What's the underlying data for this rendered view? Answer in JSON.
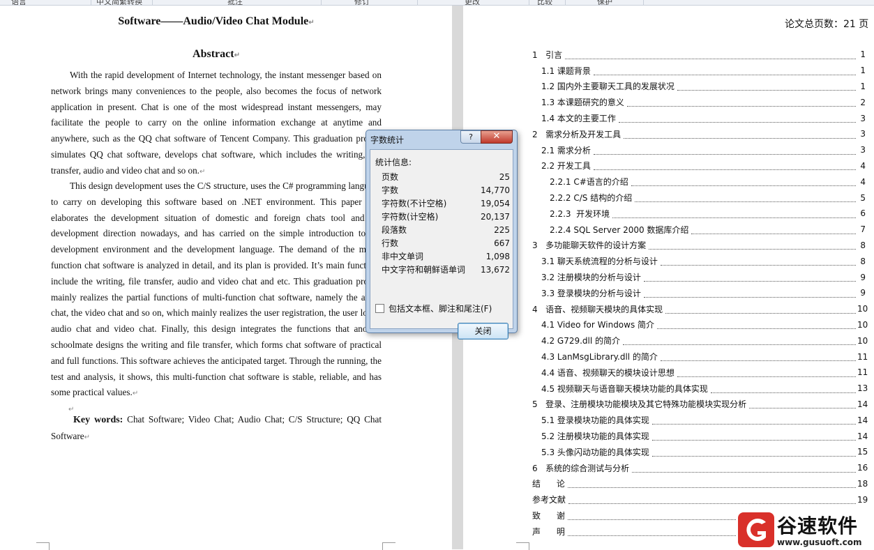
{
  "ribbon": [
    "语言",
    "中文简繁转换",
    "批注",
    "修订",
    "更改",
    "比较",
    "保护"
  ],
  "left": {
    "title": "Software——Audio/Video Chat Module",
    "abstract_heading": "Abstract",
    "para1": "With the rapid development of Internet technology, the instant messenger based on network brings many conveniences to the people, also becomes the focus of network application in present. Chat is one of the most widespread instant messengers, may facilitate the people to carry on the online information exchange at anytime and anywhere, such as the QQ chat software of Tencent Company. This graduation project simulates QQ chat software, develops chat software, which includes the writing, file transfer, audio and video chat and so on.",
    "para2": "This design development uses the C/S structure, uses the C# programming language to carry on developing this software based on .NET environment. This paper first elaborates the development situation of domestic and foreign chats tool and the development direction nowadays, and has carried on the simple introduction to the development environment and the development language. The demand of the multi-function chat software is analyzed in detail, and its plan is provided. It’s main functions include the writing, file transfer, audio and video chat and etc. This graduation project mainly realizes the partial functions of multi-function chat software, namely the audio chat, the video chat and so on, which mainly realizes the user registration, the user login, audio chat and video chat. Finally, this design integrates the functions that another schoolmate designs the writing and file transfer, which forms chat software of practical and full functions. This software achieves the anticipated target. Through the running, the test and analysis, it shows, this multi-function chat software is stable, reliable, and has some practical values.",
    "keywords_label": "Key words:",
    "keywords": " Chat Software; Video Chat; Audio Chat; C/S Structure; QQ Chat Software"
  },
  "right": {
    "total_pages": "论文总页数：21 页",
    "toc": [
      {
        "text": "1   引言",
        "page": "1",
        "level": 1
      },
      {
        "text": "1.1 课题背景",
        "page": "1",
        "level": 2
      },
      {
        "text": "1.2 国内外主要聊天工具的发展状况",
        "page": "1",
        "level": 2
      },
      {
        "text": "1.3 本课题研究的意义",
        "page": "2",
        "level": 2
      },
      {
        "text": "1.4 本文的主要工作",
        "page": "3",
        "level": 2
      },
      {
        "text": "2   需求分析及开发工具",
        "page": "3",
        "level": 1
      },
      {
        "text": "2.1 需求分析",
        "page": "3",
        "level": 2
      },
      {
        "text": "2.2 开发工具",
        "page": "4",
        "level": 2
      },
      {
        "text": "2.2.1 C#语言的介绍",
        "page": "4",
        "level": 3
      },
      {
        "text": "2.2.2 C/S 结构的介绍",
        "page": "5",
        "level": 3
      },
      {
        "text": "2.2.3  开发环境",
        "page": "6",
        "level": 3
      },
      {
        "text": "2.2.4 SQL Server 2000 数据库介绍",
        "page": "7",
        "level": 3
      },
      {
        "text": "3   多功能聊天软件的设计方案",
        "page": "8",
        "level": 1
      },
      {
        "text": "3.1 聊天系统流程的分析与设计",
        "page": "8",
        "level": 2
      },
      {
        "text": "3.2 注册模块的分析与设计",
        "page": "9",
        "level": 2
      },
      {
        "text": "3.3 登录模块的分析与设计",
        "page": "9",
        "level": 2
      },
      {
        "text": "4   语音、视频聊天模块的具体实现",
        "page": "10",
        "level": 1
      },
      {
        "text": "4.1 Video for Windows 简介",
        "page": "10",
        "level": 2
      },
      {
        "text": "4.2 G729.dll 的简介",
        "page": "10",
        "level": 2
      },
      {
        "text": "4.3 LanMsgLibrary.dll 的简介",
        "page": "11",
        "level": 2
      },
      {
        "text": "4.4 语音、视频聊天的模块设计思想",
        "page": "11",
        "level": 2
      },
      {
        "text": "4.5 视频聊天与语音聊天模块功能的具体实现",
        "page": "13",
        "level": 2
      },
      {
        "text": "5   登录、注册模块功能模块及其它特殊功能模块实现分析",
        "page": "14",
        "level": 1
      },
      {
        "text": "5.1 登录模块功能的具体实现",
        "page": "14",
        "level": 2
      },
      {
        "text": "5.2 注册模块功能的具体实现",
        "page": "14",
        "level": 2
      },
      {
        "text": "5.3 头像闪动功能的具体实现",
        "page": "15",
        "level": 2
      },
      {
        "text": "6   系统的综合测试与分析",
        "page": "16",
        "level": 1
      },
      {
        "text": "结      论",
        "page": "18",
        "level": 1
      },
      {
        "text": "参考文献",
        "page": "19",
        "level": 1
      },
      {
        "text": "致      谢",
        "page": "",
        "level": 1
      },
      {
        "text": "声      明",
        "page": "",
        "level": 1
      }
    ]
  },
  "dialog": {
    "title": "字数统计",
    "help": "?",
    "close": "✕",
    "group_label": "统计信息:",
    "stats": [
      {
        "label": "页数",
        "value": "25"
      },
      {
        "label": "字数",
        "value": "14,770"
      },
      {
        "label": "字符数(不计空格)",
        "value": "19,054"
      },
      {
        "label": "字符数(计空格)",
        "value": "20,137"
      },
      {
        "label": "段落数",
        "value": "225"
      },
      {
        "label": "行数",
        "value": "667"
      },
      {
        "label": "非中文单词",
        "value": "1,098"
      },
      {
        "label": "中文字符和朝鲜语单词",
        "value": "13,672"
      }
    ],
    "checkbox_label": "包括文本框、脚注和尾注(F)",
    "close_button": "关闭"
  },
  "watermark": {
    "name": "谷速软件",
    "url": "www.gusuoft.com"
  }
}
